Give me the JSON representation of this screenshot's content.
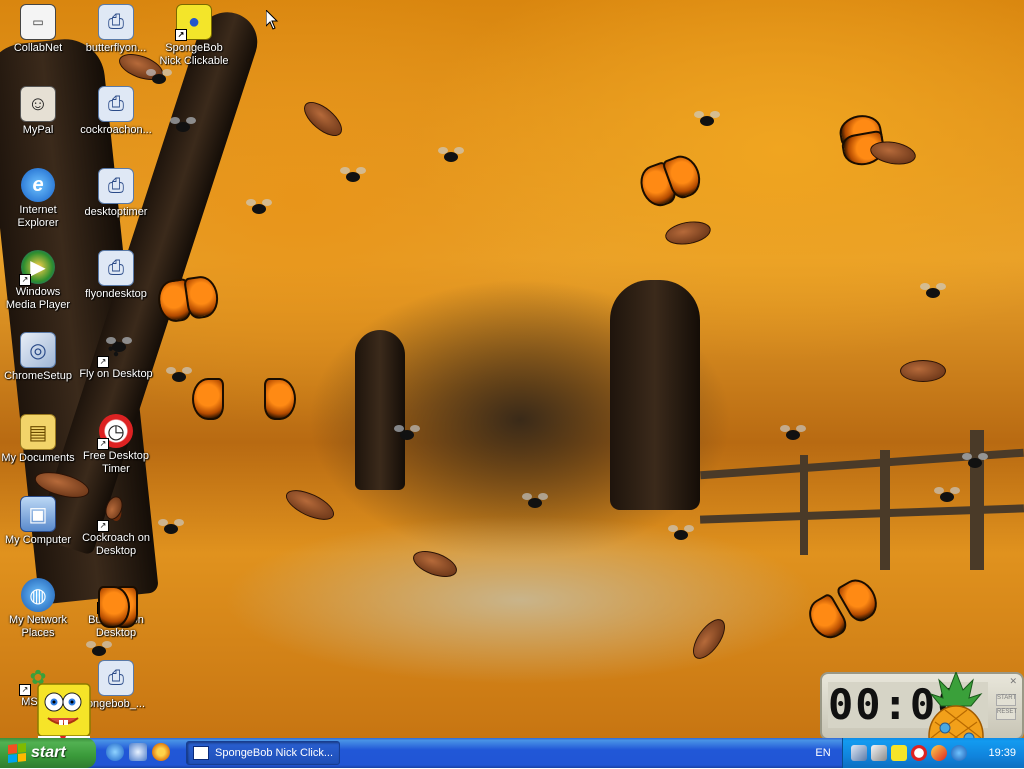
{
  "desktop": {
    "icons": [
      {
        "label": "CollabNet",
        "icon": "collabnet-icon",
        "shortcut": false
      },
      {
        "label": "butterflyon...",
        "icon": "installer-icon",
        "shortcut": false
      },
      {
        "label": "SpongeBob Nick Clickable",
        "icon": "spongebob-icon",
        "shortcut": true
      },
      {
        "label": "MyPal",
        "icon": "mypal-icon",
        "shortcut": false
      },
      {
        "label": "cockroachon...",
        "icon": "installer-icon",
        "shortcut": false
      },
      {
        "label": "Internet Explorer",
        "icon": "internet-explorer-icon",
        "shortcut": false
      },
      {
        "label": "desktoptimer",
        "icon": "installer-icon",
        "shortcut": false
      },
      {
        "label": "Windows Media Player",
        "icon": "media-player-icon",
        "shortcut": true
      },
      {
        "label": "flyondesktop",
        "icon": "installer-icon",
        "shortcut": false
      },
      {
        "label": "ChromeSetup",
        "icon": "chrome-setup-icon",
        "shortcut": false
      },
      {
        "label": "Fly on Desktop",
        "icon": "fly-icon",
        "shortcut": true
      },
      {
        "label": "My Documents",
        "icon": "my-documents-icon",
        "shortcut": false
      },
      {
        "label": "Free Desktop Timer",
        "icon": "clock-icon",
        "shortcut": true
      },
      {
        "label": "My Computer",
        "icon": "my-computer-icon",
        "shortcut": false
      },
      {
        "label": "Cockroach on Desktop",
        "icon": "cockroach-icon",
        "shortcut": true
      },
      {
        "label": "My Network Places",
        "icon": "network-places-icon",
        "shortcut": false
      },
      {
        "label": "Butterfly on Desktop",
        "icon": "butterfly-icon",
        "shortcut": true
      },
      {
        "label": "MSN 1",
        "icon": "msn-icon",
        "shortcut": true
      },
      {
        "label": "ongebob_...",
        "icon": "installer-icon",
        "shortcut": false
      }
    ]
  },
  "timer": {
    "display": "00:00",
    "buttons": [
      "START",
      "RESET"
    ]
  },
  "taskbar": {
    "start_label": "start",
    "quick_launch": [
      "internet-explorer-icon",
      "show-desktop-icon",
      "media-player-icon"
    ],
    "task_button": "SpongeBob Nick Click...",
    "language": "EN",
    "tray_icons": [
      "network-icon",
      "volume-icon",
      "spongebob-icon",
      "timer-icon",
      "security-icon",
      "update-icon"
    ],
    "clock": "19:39"
  },
  "colors": {
    "taskbar": "#2156d5",
    "start": "#3a9a3a",
    "tray": "#1084dd"
  }
}
